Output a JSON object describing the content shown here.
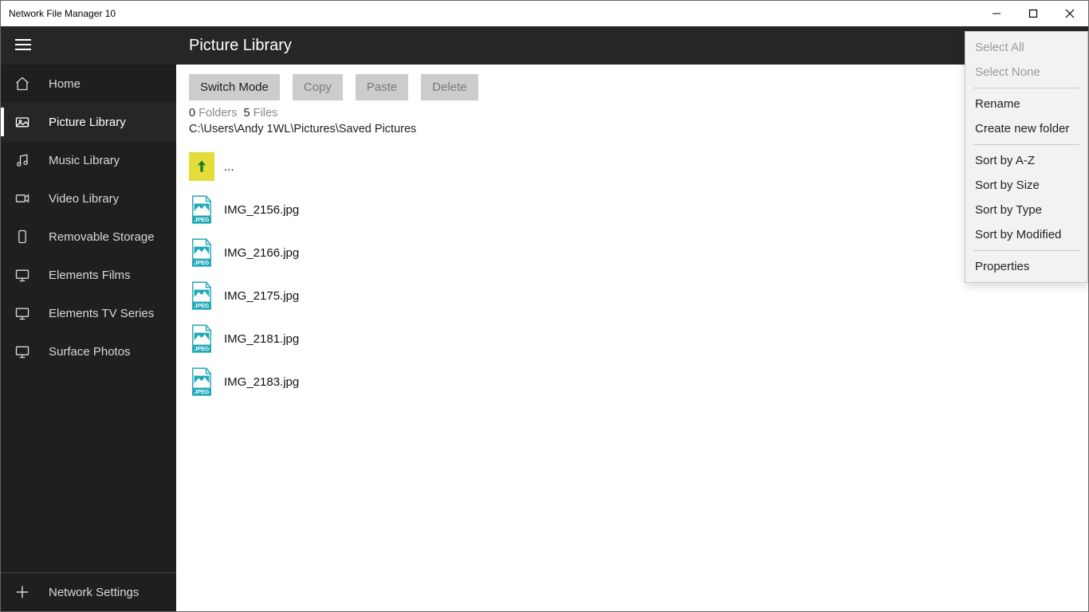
{
  "window": {
    "title": "Network File Manager 10"
  },
  "sidebar": {
    "items": [
      {
        "icon": "home-icon",
        "label": "Home"
      },
      {
        "icon": "picture-icon",
        "label": "Picture Library"
      },
      {
        "icon": "music-icon",
        "label": "Music Library"
      },
      {
        "icon": "video-icon",
        "label": "Video Library"
      },
      {
        "icon": "storage-icon",
        "label": "Removable Storage"
      },
      {
        "icon": "monitor-icon",
        "label": "Elements Films"
      },
      {
        "icon": "monitor-icon",
        "label": "Elements TV Series"
      },
      {
        "icon": "monitor-icon",
        "label": "Surface Photos"
      }
    ],
    "footer": {
      "label": "Network Settings"
    }
  },
  "header": {
    "title": "Picture Library",
    "more": "⋯"
  },
  "toolbar": {
    "switch_mode": "Switch Mode",
    "copy": "Copy",
    "paste": "Paste",
    "delete": "Delete"
  },
  "status": {
    "folders_count": "0",
    "folders_label": "Folders",
    "files_count": "5",
    "files_label": "Files",
    "path": "C:\\Users\\Andy 1WL\\Pictures\\Saved Pictures"
  },
  "files": {
    "up": "...",
    "list": [
      "IMG_2156.jpg",
      "IMG_2166.jpg",
      "IMG_2175.jpg",
      "IMG_2181.jpg",
      "IMG_2183.jpg"
    ]
  },
  "menu": {
    "select_all": "Select All",
    "select_none": "Select None",
    "rename": "Rename",
    "create_folder": "Create new folder",
    "sort_az": "Sort by A-Z",
    "sort_size": "Sort by Size",
    "sort_type": "Sort by Type",
    "sort_modified": "Sort by Modified",
    "properties": "Properties"
  }
}
